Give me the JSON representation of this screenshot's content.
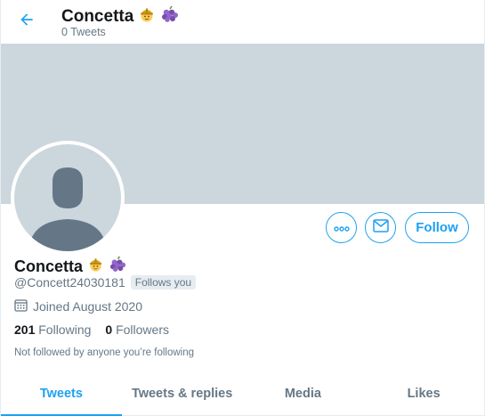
{
  "header": {
    "name": "Concetta",
    "subtitle": "0 Tweets"
  },
  "icons": {
    "back": "arrow-left-icon",
    "more": "more-horizontal-icon",
    "message": "envelope-icon",
    "calendar": "calendar-icon",
    "emoji_1": "construction-worker-emoji",
    "emoji_2": "grapes-emoji"
  },
  "colors": {
    "accent": "#1da1f2",
    "banner": "#ccd6dd",
    "secondary_text": "#657786"
  },
  "actions": {
    "follow_label": "Follow"
  },
  "profile": {
    "name": "Concetta",
    "handle": "@Concett24030181",
    "follows_you": "Follows you",
    "joined": "Joined August 2020",
    "following_count": "201",
    "following_label": "Following",
    "followers_count": "0",
    "followers_label": "Followers",
    "not_followed": "Not followed by anyone you’re following"
  },
  "tabs": [
    {
      "label": "Tweets",
      "active": true
    },
    {
      "label": "Tweets & replies",
      "active": false
    },
    {
      "label": "Media",
      "active": false
    },
    {
      "label": "Likes",
      "active": false
    }
  ]
}
